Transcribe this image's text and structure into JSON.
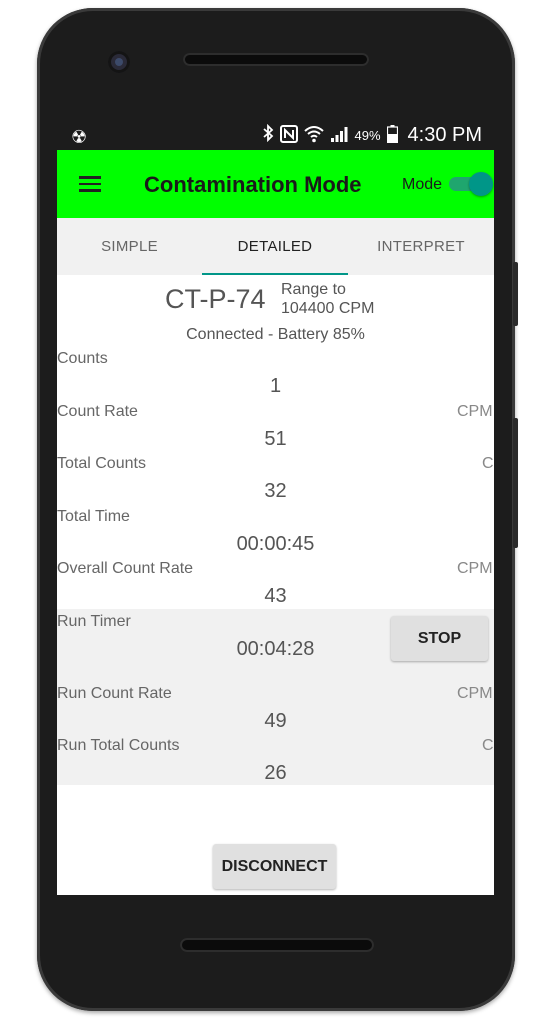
{
  "status_bar": {
    "notification_icon": "radiation-icon",
    "icons": [
      "bluetooth-icon",
      "nfc-icon",
      "wifi-icon",
      "signal-icon"
    ],
    "battery_percent": "49%",
    "time": "4:30 PM"
  },
  "app_bar": {
    "title": "Contamination Mode",
    "mode_label": "Mode",
    "mode_toggle_on": true,
    "background_color": "#00ff00",
    "toggle_color": "#009688"
  },
  "tabs": [
    {
      "label": "SIMPLE"
    },
    {
      "label": "DETAILED",
      "selected": true
    },
    {
      "label": "INTERPRET"
    }
  ],
  "device": {
    "name": "CT-P-74",
    "range_line1": "Range to",
    "range_line2": "104400 CPM",
    "connection": "Connected - Battery 85%"
  },
  "readings": {
    "counts": {
      "label": "Counts",
      "value": "1"
    },
    "count_rate": {
      "label": "Count Rate",
      "unit": "CPM",
      "value": "51"
    },
    "total_counts": {
      "label": "Total Counts",
      "unit": "C",
      "value": "32"
    },
    "total_time": {
      "label": "Total Time",
      "value": "00:00:45"
    },
    "overall_count_rate": {
      "label": "Overall Count Rate",
      "unit": "CPM",
      "value": "43"
    }
  },
  "run": {
    "timer_label": "Run Timer",
    "timer_value": "00:04:28",
    "stop_label": "STOP",
    "rate_label": "Run Count Rate",
    "rate_unit": "CPM",
    "rate_value": "49",
    "total_label": "Run Total Counts",
    "total_unit": "C",
    "total_value": "26"
  },
  "footer": {
    "disconnect_label": "DISCONNECT"
  }
}
